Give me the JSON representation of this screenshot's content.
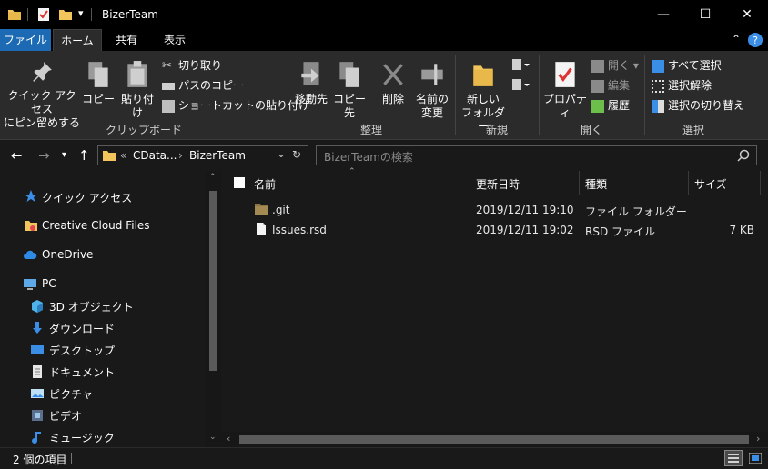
{
  "window": {
    "title": "BizerTeam",
    "minimize_glyph": "—",
    "maximize_glyph": "☐",
    "close_glyph": "✕"
  },
  "ribbon_tabs": {
    "file": "ファイル",
    "home": "ホーム",
    "share": "共有",
    "view": "表示"
  },
  "ribbon": {
    "clipboard": {
      "label": "クリップボード",
      "pin_line1": "クイック アクセス",
      "pin_line2": "にピン留めする",
      "copy": "コピー",
      "paste": "貼り付け",
      "cut": "切り取り",
      "copy_path": "パスのコピー",
      "paste_shortcut": "ショートカットの貼り付け"
    },
    "organize": {
      "label": "整理",
      "move_to": "移動先",
      "copy_to": "コピー先",
      "delete": "削除",
      "rename_line1": "名前の",
      "rename_line2": "変更"
    },
    "new": {
      "label": "新規",
      "new_folder_line1": "新しい",
      "new_folder_line2": "フォルダー"
    },
    "open": {
      "label": "開く",
      "properties": "プロパティ",
      "open": "開く",
      "edit": "編集",
      "history": "履歴"
    },
    "select": {
      "label": "選択",
      "select_all": "すべて選択",
      "select_none": "選択解除",
      "invert": "選択の切り替え"
    }
  },
  "address": {
    "crumb_prefix": "«",
    "crumb1": "CData...",
    "crumb_sep": "›",
    "crumb2": "BizerTeam",
    "search_placeholder": "BizerTeamの検索"
  },
  "nav_pane": {
    "quick_access": "クイック アクセス",
    "creative_cloud": "Creative Cloud Files",
    "onedrive": "OneDrive",
    "pc": "PC",
    "objects3d": "3D オブジェクト",
    "downloads": "ダウンロード",
    "desktop": "デスクトップ",
    "documents": "ドキュメント",
    "pictures": "ピクチャ",
    "videos": "ビデオ",
    "music": "ミュージック"
  },
  "columns": {
    "name": "名前",
    "modified": "更新日時",
    "type": "種類",
    "size": "サイズ"
  },
  "files": [
    {
      "name": ".git",
      "modified": "2019/12/11 19:10",
      "type": "ファイル フォルダー",
      "size": ""
    },
    {
      "name": "Issues.rsd",
      "modified": "2019/12/11 19:02",
      "type": "RSD ファイル",
      "size": "7 KB"
    }
  ],
  "status": {
    "item_count": "2 個の項目"
  },
  "colors": {
    "accent": "#1b6ab3",
    "folder": "#f2c55c",
    "help": "#3a8ee6"
  }
}
